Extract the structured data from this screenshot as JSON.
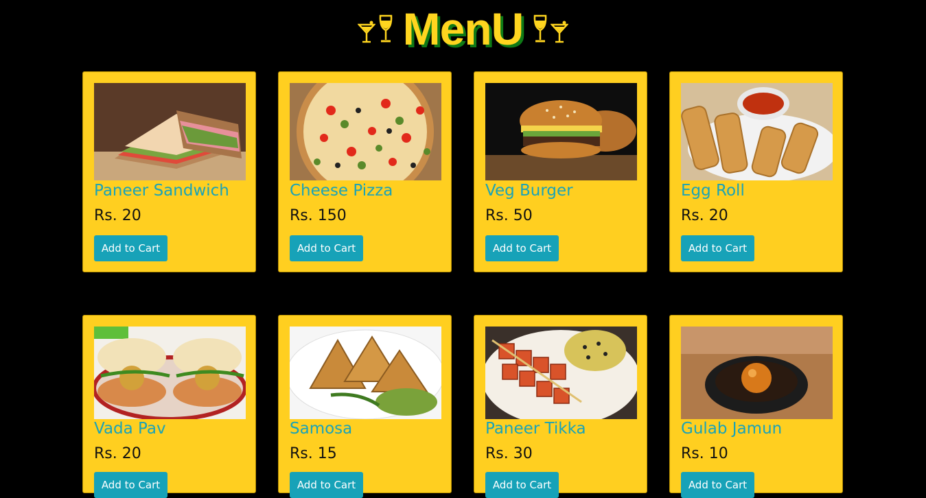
{
  "header": {
    "title": "MenU",
    "left_icons": [
      "cocktail-glass-icon",
      "wine-glass-icon"
    ],
    "right_icons": [
      "wine-glass-icon",
      "cocktail-glass-icon"
    ]
  },
  "colors": {
    "background": "#000000",
    "card": "#ffcf20",
    "title": "#ffd51f",
    "title_shadow": "#0f7a16",
    "item_name": "#1aa3b8",
    "button": "#17a2b8"
  },
  "menu": {
    "items": [
      {
        "name": "Paneer Sandwich",
        "price": "Rs. 20",
        "button": "Add to Cart",
        "image": "sandwich"
      },
      {
        "name": "Cheese Pizza",
        "price": "Rs. 150",
        "button": "Add to Cart",
        "image": "pizza"
      },
      {
        "name": "Veg Burger",
        "price": "Rs. 50",
        "button": "Add to Cart",
        "image": "burger"
      },
      {
        "name": "Egg Roll",
        "price": "Rs. 20",
        "button": "Add to Cart",
        "image": "egg-roll"
      },
      {
        "name": "Vada Pav",
        "price": "Rs. 20",
        "button": "Add to Cart",
        "image": "vada-pav"
      },
      {
        "name": "Samosa",
        "price": "Rs. 15",
        "button": "Add to Cart",
        "image": "samosa"
      },
      {
        "name": "Paneer Tikka",
        "price": "Rs. 30",
        "button": "Add to Cart",
        "image": "paneer-tikka"
      },
      {
        "name": "Gulab Jamun",
        "price": "Rs. 10",
        "button": "Add to Cart",
        "image": "gulab-jamun"
      }
    ]
  }
}
